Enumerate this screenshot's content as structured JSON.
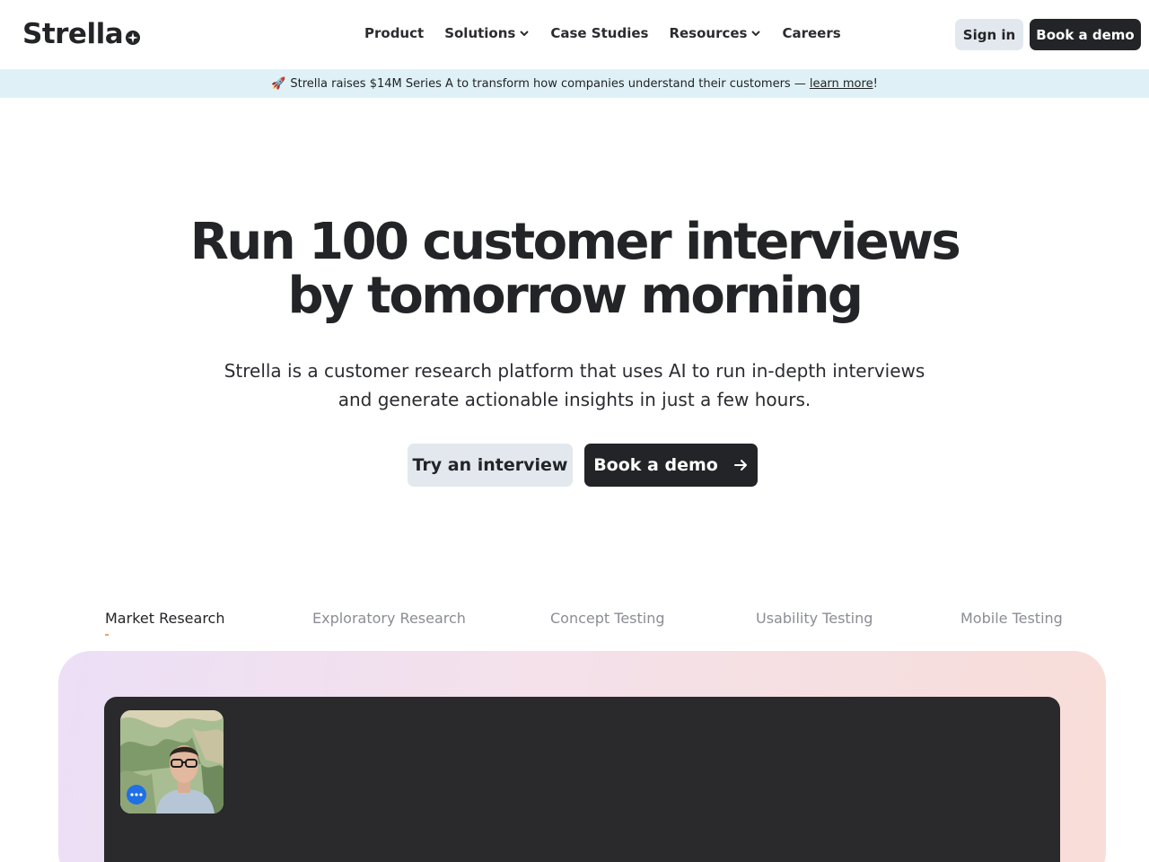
{
  "header": {
    "logo": "Strella",
    "nav": [
      {
        "label": "Product",
        "dropdown": false
      },
      {
        "label": "Solutions",
        "dropdown": true
      },
      {
        "label": "Case Studies",
        "dropdown": false
      },
      {
        "label": "Resources",
        "dropdown": true
      },
      {
        "label": "Careers",
        "dropdown": false
      }
    ],
    "sign_in": "Sign in",
    "book_demo": "Book a demo"
  },
  "banner": {
    "icon": "rocket-icon",
    "text": "Strella raises $14M Series A to transform how companies understand their customers —",
    "link": "learn more",
    "suffix": "!"
  },
  "hero": {
    "title_line1": "Run 100 customer interviews",
    "title_line2": "by tomorrow morning",
    "subtitle_line1": "Strella is a customer research platform that uses AI to run in-depth interviews",
    "subtitle_line2": "and generate actionable insights in just a few hours.",
    "try_button": "Try an interview",
    "demo_button": "Book a demo"
  },
  "tabs": [
    {
      "label": "Market Research",
      "active": true
    },
    {
      "label": "Exploratory Research",
      "active": false
    },
    {
      "label": "Concept Testing",
      "active": false
    },
    {
      "label": "Usability Testing",
      "active": false
    },
    {
      "label": "Mobile Testing",
      "active": false
    }
  ],
  "colors": {
    "dark": "#232427",
    "light_button": "#e3e8ef",
    "banner_bg": "#dff1f6",
    "accent_blue": "#1f6fe5",
    "tab_indicator": "#f2a36b"
  }
}
